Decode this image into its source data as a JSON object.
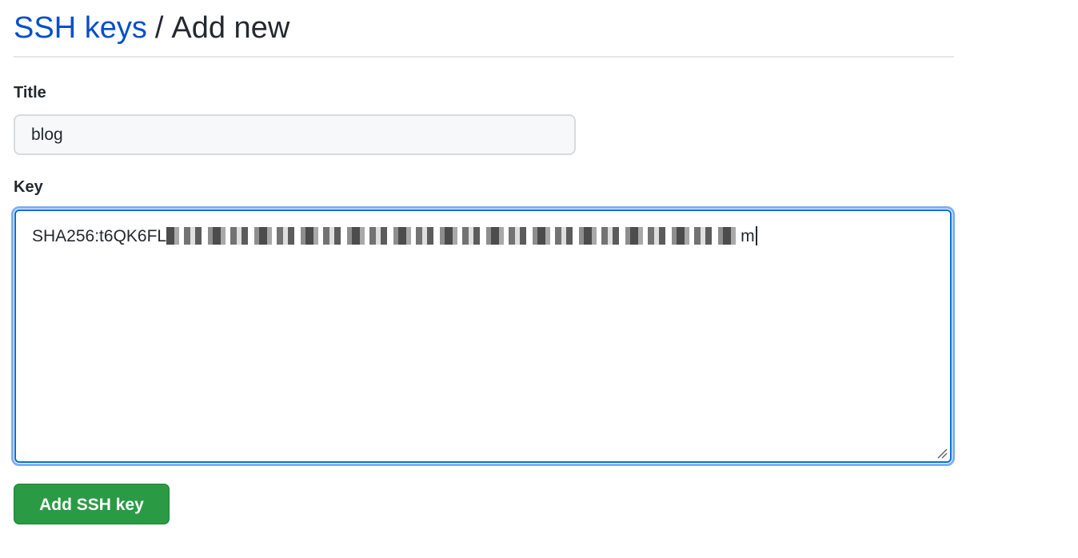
{
  "breadcrumb": {
    "parent_label": "SSH keys",
    "separator": "/",
    "current_label": "Add new"
  },
  "form": {
    "title_label": "Title",
    "title_value": "blog",
    "key_label": "Key",
    "key_value_start": "SHA256:t6QK6FL",
    "key_value_end": "m",
    "submit_label": "Add SSH key"
  },
  "colors": {
    "link": "#0550c8",
    "focus_border": "#0969da",
    "button_bg": "#2a9b44"
  }
}
